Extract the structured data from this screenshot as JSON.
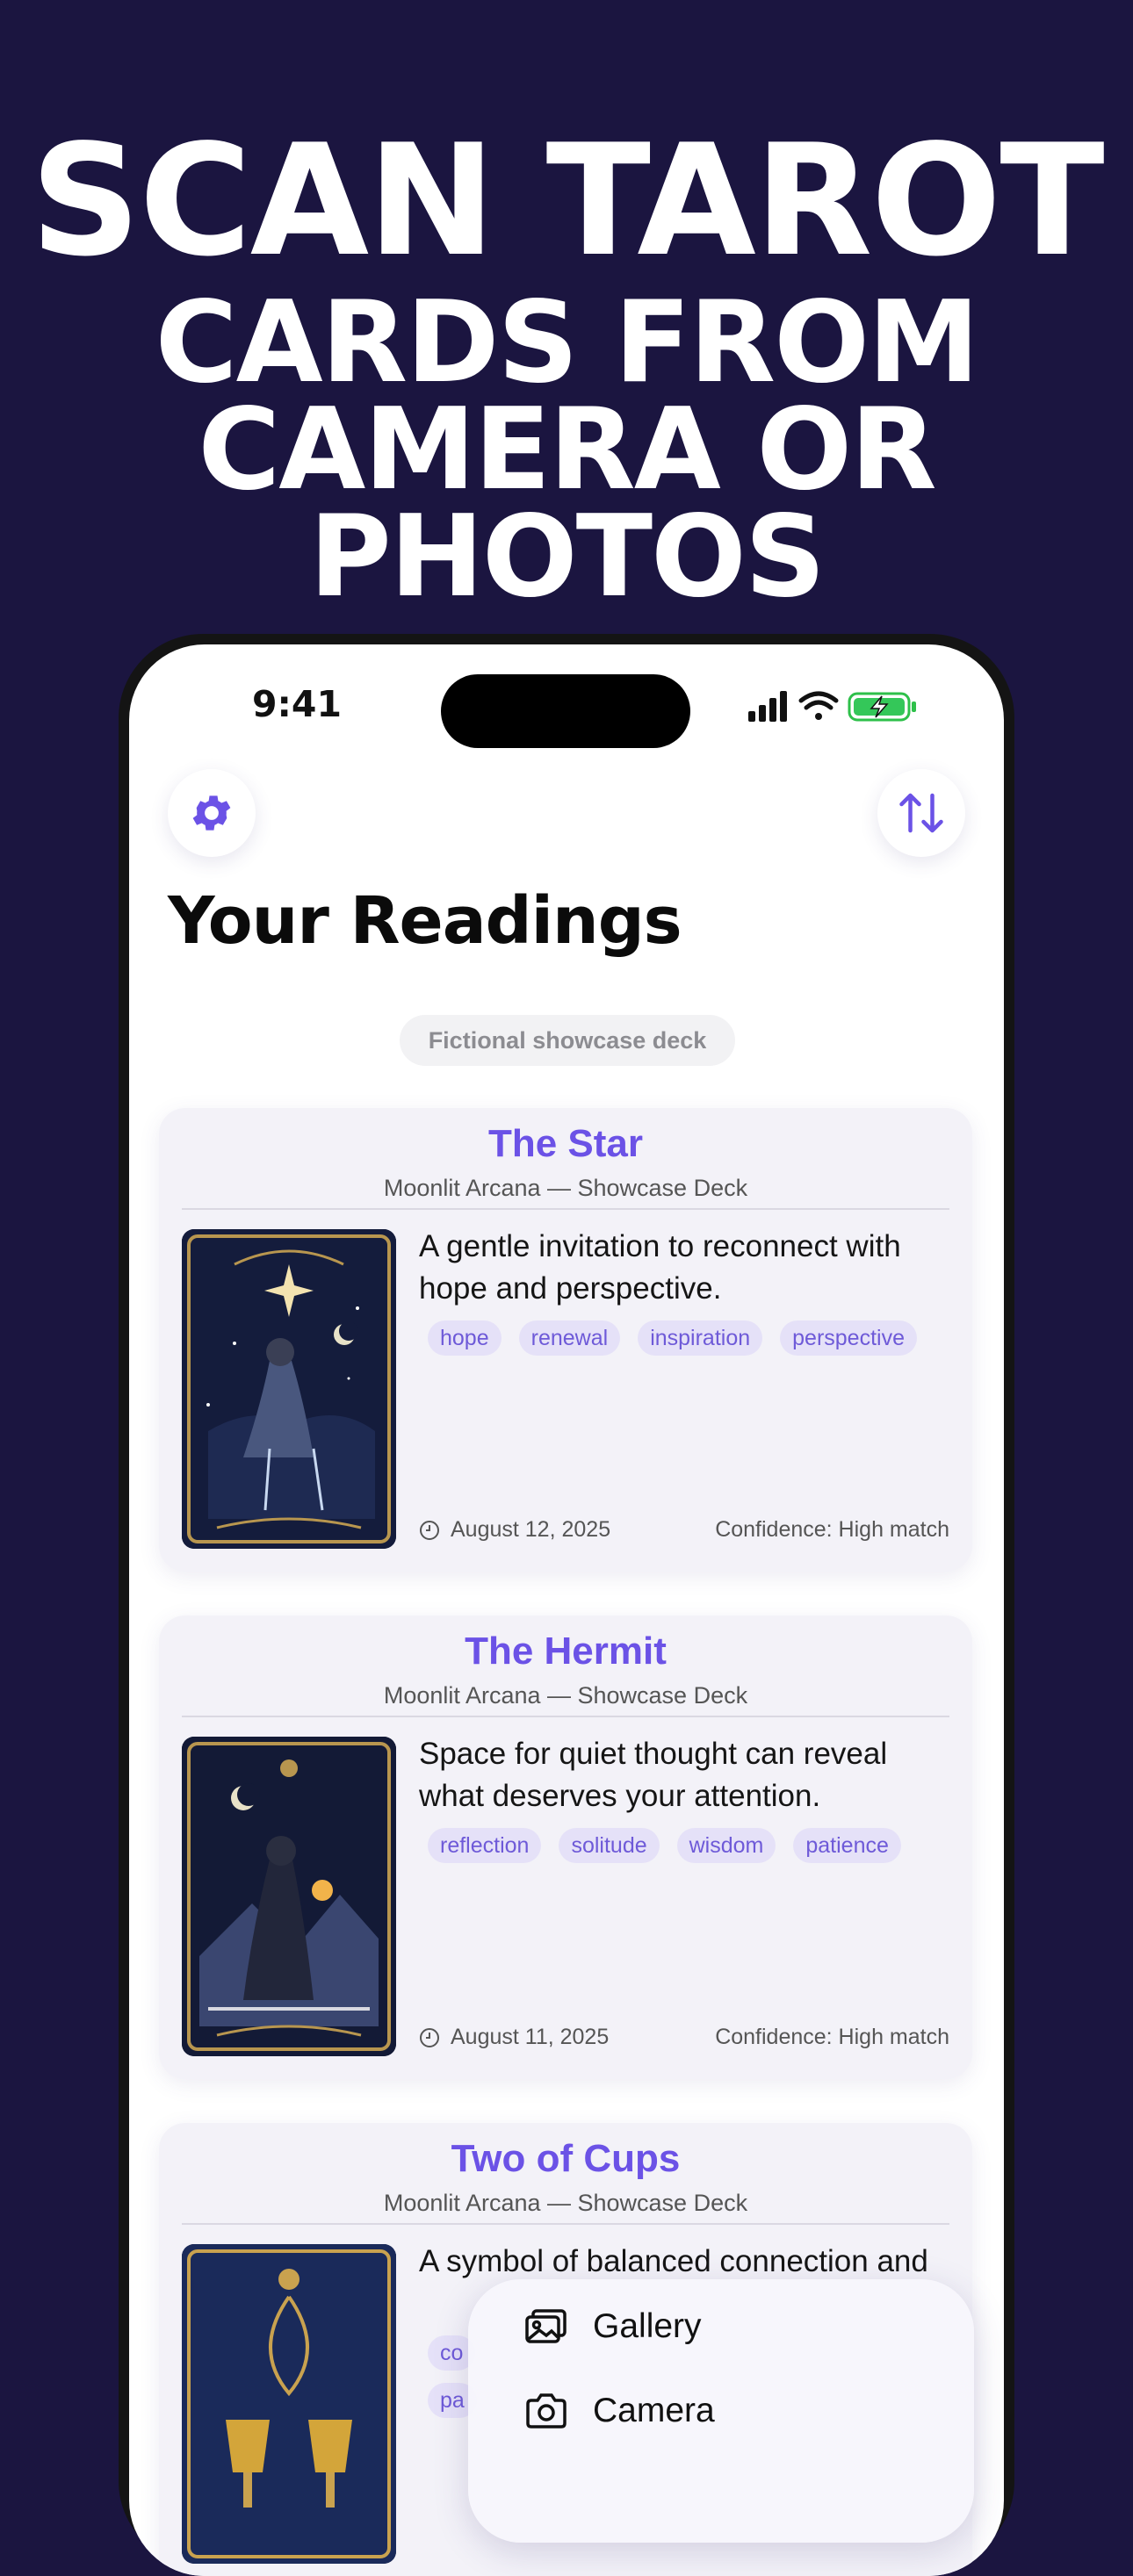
{
  "headline": {
    "line1": "SCAN TAROT",
    "line2": "CARDS FROM CAMERA OR PHOTOS"
  },
  "status_bar": {
    "time": "9:41",
    "icons": [
      "cellular-signal-icon",
      "wifi-icon",
      "battery-charging-icon"
    ]
  },
  "toolbar": {
    "settings_icon": "gear-icon",
    "sort_icon": "sort-arrows-icon"
  },
  "page": {
    "title": "Your Readings",
    "deck_pill": "Fictional showcase deck"
  },
  "readings": [
    {
      "title": "The Star",
      "deck": "Moonlit Arcana — Showcase Deck",
      "description": "A gentle invitation to reconnect with hope and perspective.",
      "tags": [
        "hope",
        "renewal",
        "inspiration",
        "perspective"
      ],
      "date": "August 12, 2025",
      "confidence": "Confidence: High match"
    },
    {
      "title": "The Hermit",
      "deck": "Moonlit Arcana — Showcase Deck",
      "description": "Space for quiet thought can reveal what deserves your attention.",
      "tags": [
        "reflection",
        "solitude",
        "wisdom",
        "patience"
      ],
      "date": "August 11, 2025",
      "confidence": "Confidence: High match"
    },
    {
      "title": "Two of Cups",
      "deck": "Moonlit Arcana — Showcase Deck",
      "description": "A symbol of balanced connection and",
      "tags": [
        "co",
        "pa"
      ],
      "date": "",
      "confidence": ""
    }
  ],
  "action_sheet": {
    "items": [
      {
        "label": "Gallery",
        "icon": "photo-gallery-icon"
      },
      {
        "label": "Camera",
        "icon": "camera-icon"
      }
    ]
  },
  "colors": {
    "background": "#1b1540",
    "accent": "#6b52e6",
    "tag_bg": "#e5e1f8"
  }
}
